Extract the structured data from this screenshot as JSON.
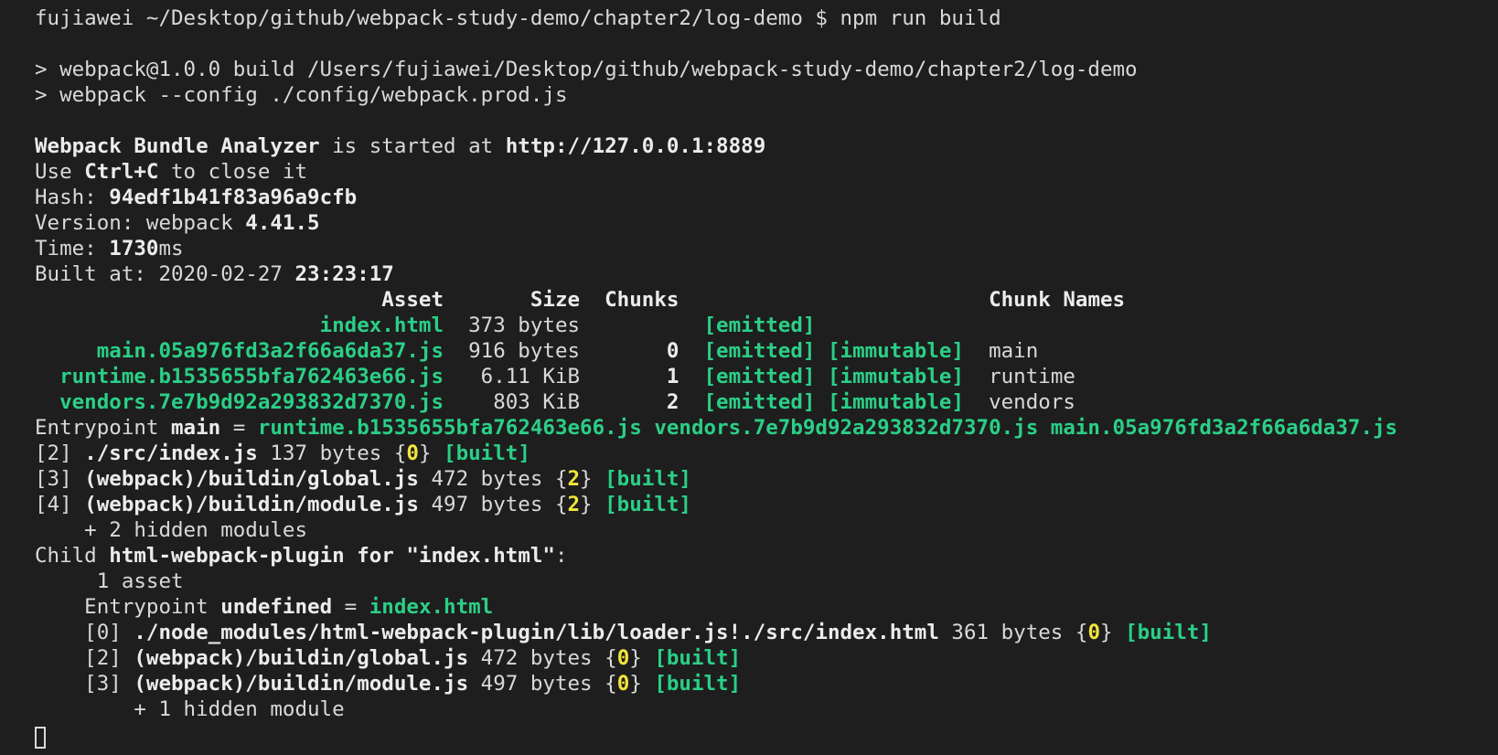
{
  "prompt": {
    "user": "fujiawei",
    "cwd": "~/Desktop/github/webpack-study-demo/chapter2/log-demo",
    "symbol": "$",
    "command": "npm run build"
  },
  "npm": {
    "script_line": "> webpack@1.0.0 build /Users/fujiawei/Desktop/github/webpack-study-demo/chapter2/log-demo",
    "command_line": "> webpack --config ./config/webpack.prod.js"
  },
  "analyzer": {
    "name": "Webpack Bundle Analyzer",
    "started_text": " is started at ",
    "url": "http://127.0.0.1:8889",
    "close_prefix": "Use ",
    "close_key": "Ctrl+C",
    "close_suffix": " to close it"
  },
  "stats": {
    "hash_label": "Hash: ",
    "hash": "94edf1b41f83a96a9cfb",
    "version_label": "Version: webpack ",
    "version": "4.41.5",
    "time_label": "Time: ",
    "time_value": "1730",
    "time_unit": "ms",
    "built_label": "Built at: 2020-02-27 ",
    "built_time": "23:23:17"
  },
  "asset_table": {
    "headers": {
      "asset": "Asset",
      "size": "Size",
      "chunks": "Chunks",
      "chunk_names": "Chunk Names"
    },
    "rows": [
      {
        "asset": "index.html",
        "size": "373 bytes",
        "chunk": "",
        "emitted": "[emitted]",
        "immutable": "",
        "name": ""
      },
      {
        "asset": "main.05a976fd3a2f66a6da37.js",
        "size": "916 bytes",
        "chunk": "0",
        "emitted": "[emitted]",
        "immutable": "[immutable]",
        "name": "main"
      },
      {
        "asset": "runtime.b1535655bfa762463e66.js",
        "size": "6.11 KiB",
        "chunk": "1",
        "emitted": "[emitted]",
        "immutable": "[immutable]",
        "name": "runtime"
      },
      {
        "asset": "vendors.7e7b9d92a293832d7370.js",
        "size": "803 KiB",
        "chunk": "2",
        "emitted": "[emitted]",
        "immutable": "[immutable]",
        "name": "vendors"
      }
    ]
  },
  "entrypoint": {
    "label": "Entrypoint ",
    "name": "main",
    "eq": " = ",
    "files": "runtime.b1535655bfa762463e66.js vendors.7e7b9d92a293832d7370.js main.05a976fd3a2f66a6da37.js"
  },
  "modules": [
    {
      "id": "[2] ",
      "path": "./src/index.js",
      "size": " 137 bytes {",
      "chunk": "0",
      "close": "} ",
      "status": "[built]"
    },
    {
      "id": "[3] ",
      "path": "(webpack)/buildin/global.js",
      "size": " 472 bytes {",
      "chunk": "2",
      "close": "} ",
      "status": "[built]"
    },
    {
      "id": "[4] ",
      "path": "(webpack)/buildin/module.js",
      "size": " 497 bytes {",
      "chunk": "2",
      "close": "} ",
      "status": "[built]"
    }
  ],
  "hidden_modules": "    + 2 hidden modules",
  "child": {
    "prefix": "Child ",
    "name": "html-webpack-plugin",
    "for_text": " for \"index.html\"",
    "colon": ":",
    "asset_count": "     1 asset",
    "entry_label": "    Entrypoint ",
    "entry_name": "undefined",
    "entry_eq": " = ",
    "entry_file": "index.html",
    "modules": [
      {
        "id": "    [0] ",
        "path": "./node_modules/html-webpack-plugin/lib/loader.js!./src/index.html",
        "size": " 361 bytes {",
        "chunk": "0",
        "close": "} ",
        "status": "[built]"
      },
      {
        "id": "    [2] ",
        "path": "(webpack)/buildin/global.js",
        "size": " 472 bytes {",
        "chunk": "0",
        "close": "} ",
        "status": "[built]"
      },
      {
        "id": "    [3] ",
        "path": "(webpack)/buildin/module.js",
        "size": " 497 bytes {",
        "chunk": "0",
        "close": "} ",
        "status": "[built]"
      }
    ],
    "hidden_modules": "        + 1 hidden module"
  },
  "colors": {
    "background": "#1e1e1e",
    "text": "#d9d9d9",
    "green": "#2bcf86",
    "yellow": "#f2e53c"
  }
}
